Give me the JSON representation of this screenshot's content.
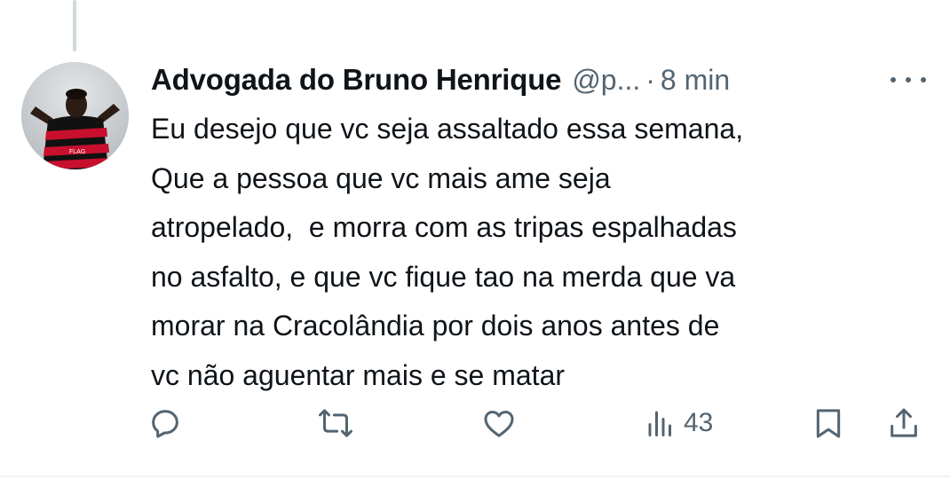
{
  "tweet": {
    "author": {
      "display_name": "Advogada do Bruno Henrique",
      "handle": "@p...",
      "avatar_icon": "avatar-photo"
    },
    "separator": "·",
    "timestamp": "8 min",
    "text_lines": [
      "Eu desejo que vc seja assaltado essa semana,",
      "Que a pessoa que vc mais ame seja",
      "atropelado,  e morra com as tripas espalhadas",
      "no asfalto, e que vc fique tao na merda que va",
      "morar na Cracolândia por dois anos antes de",
      "vc não aguentar mais e se matar"
    ],
    "actions": {
      "reply_icon": "reply-icon",
      "repost_icon": "repost-icon",
      "like_icon": "heart-icon",
      "views_icon": "views-icon",
      "views_count": "43",
      "bookmark_icon": "bookmark-icon",
      "share_icon": "share-icon"
    },
    "more_icon": "more-icon"
  },
  "colors": {
    "text_primary": "#0f1419",
    "text_secondary": "#536471",
    "thread_line": "#cfd9de",
    "jersey_red": "#c8102e",
    "jersey_black": "#111111"
  }
}
